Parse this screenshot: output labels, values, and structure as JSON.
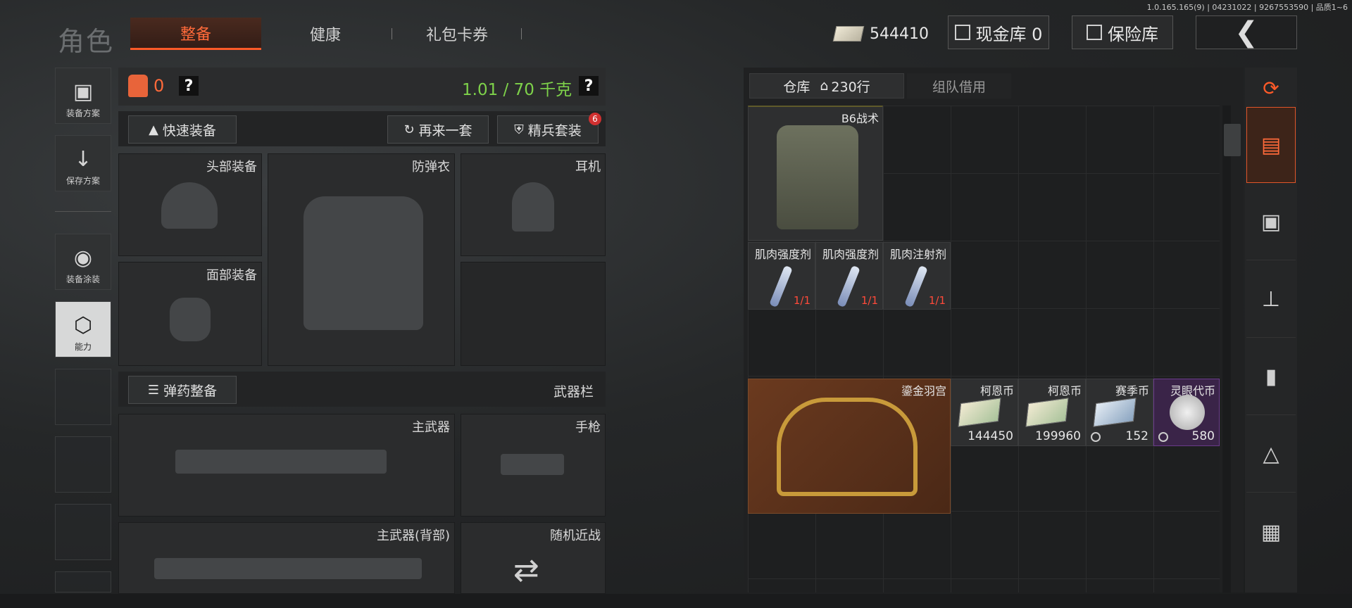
{
  "version": "1.0.165.165(9) | 04231022 | 9267553590 | 品质1~6",
  "header": {
    "title": "角色",
    "tabs": [
      {
        "label": "整备",
        "active": true
      },
      {
        "label": "健康",
        "active": false
      },
      {
        "label": "礼包卡券",
        "active": false
      }
    ],
    "currency": "544410",
    "cash_vault": "现金库 0",
    "insurance": "保险库",
    "back_icon": "back-chevron-icon"
  },
  "sidebar": {
    "items": [
      {
        "label": "装备方案",
        "icon": "vest-icon"
      },
      {
        "label": "保存方案",
        "icon": "download-icon"
      },
      {
        "label": "装备涂装",
        "icon": "helmet-paint-icon"
      },
      {
        "label": "能力",
        "icon": "ability-icon",
        "active": true
      }
    ]
  },
  "equipment": {
    "armor_count": "0",
    "weight": "1.01 / 70 千克",
    "quick_equip": "快速装备",
    "another_set": "再来一套",
    "elite_set": "精兵套装",
    "elite_badge": "6",
    "slots": {
      "head": "头部装备",
      "armor": "防弹衣",
      "headset": "耳机",
      "face": "面部装备"
    },
    "ammo_btn": "弹药整备",
    "weapon_bar": "武器栏",
    "primary": "主武器",
    "pistol": "手枪",
    "primary_back": "主武器(背部)",
    "melee": "随机近战"
  },
  "warehouse": {
    "tab_storage": "仓库",
    "tab_storage_count": "230行",
    "tab_team": "组队借用",
    "items": [
      {
        "name": "B6战术",
        "count": ""
      },
      {
        "name": "肌肉强度剂",
        "count": "1/1"
      },
      {
        "name": "肌肉强度剂",
        "count": "1/1"
      },
      {
        "name": "肌肉注射剂",
        "count": "1/1"
      },
      {
        "name": "鎏金羽宫",
        "count": ""
      },
      {
        "name": "柯恩币",
        "count": "144450"
      },
      {
        "name": "柯恩币",
        "count": "199960"
      },
      {
        "name": "赛季币",
        "count": "152"
      },
      {
        "name": "灵眼代币",
        "count": "580"
      }
    ]
  },
  "colors": {
    "accent": "#ff5a28",
    "weight_green": "#7ed24a"
  }
}
